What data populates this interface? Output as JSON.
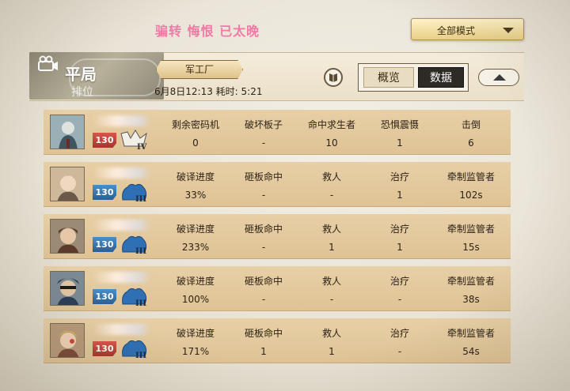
{
  "page": {
    "title": "骗转 悔恨 已太晚",
    "mode_select": {
      "value": "全部模式"
    }
  },
  "header": {
    "mode": "平局",
    "mode_sub": "排位",
    "map": "军工厂",
    "match_time": "6月8日12:13 耗时: 5:21",
    "tabs": [
      {
        "label": "概览",
        "active": false
      },
      {
        "label": "数据",
        "active": true
      }
    ]
  },
  "colors": {
    "hunter_level": "#c0463a",
    "survivor_level": "#3b79b3",
    "row_bg": "#e3c99d",
    "active_tab": "#2e2a26",
    "title_pink": "#f07aa6"
  },
  "players": [
    {
      "role": "hunter",
      "level": "130",
      "rank": "IV",
      "stats": [
        {
          "label": "剩余密码机",
          "value": "0"
        },
        {
          "label": "破坏板子",
          "value": "-"
        },
        {
          "label": "命中求生者",
          "value": "10"
        },
        {
          "label": "恐惧震慑",
          "value": "1"
        },
        {
          "label": "击倒",
          "value": "6"
        }
      ]
    },
    {
      "role": "survivor",
      "level": "130",
      "rank": "III",
      "stats": [
        {
          "label": "破译进度",
          "value": "33%"
        },
        {
          "label": "砸板命中",
          "value": "-"
        },
        {
          "label": "救人",
          "value": "-"
        },
        {
          "label": "治疗",
          "value": "1"
        },
        {
          "label": "牵制监管者",
          "value": "102s"
        }
      ]
    },
    {
      "role": "survivor",
      "level": "130",
      "rank": "III",
      "stats": [
        {
          "label": "破译进度",
          "value": "233%"
        },
        {
          "label": "砸板命中",
          "value": "-"
        },
        {
          "label": "救人",
          "value": "1"
        },
        {
          "label": "治疗",
          "value": "1"
        },
        {
          "label": "牵制监管者",
          "value": "15s"
        }
      ]
    },
    {
      "role": "survivor",
      "level": "130",
      "rank": "III",
      "stats": [
        {
          "label": "破译进度",
          "value": "100%"
        },
        {
          "label": "砸板命中",
          "value": "-"
        },
        {
          "label": "救人",
          "value": "-"
        },
        {
          "label": "治疗",
          "value": "-"
        },
        {
          "label": "牵制监管者",
          "value": "38s"
        }
      ]
    },
    {
      "role": "survivor",
      "level": "130",
      "rank": "III",
      "stats": [
        {
          "label": "破译进度",
          "value": "171%"
        },
        {
          "label": "砸板命中",
          "value": "1"
        },
        {
          "label": "救人",
          "value": "1"
        },
        {
          "label": "治疗",
          "value": "-"
        },
        {
          "label": "牵制监管者",
          "value": "54s"
        }
      ]
    }
  ]
}
